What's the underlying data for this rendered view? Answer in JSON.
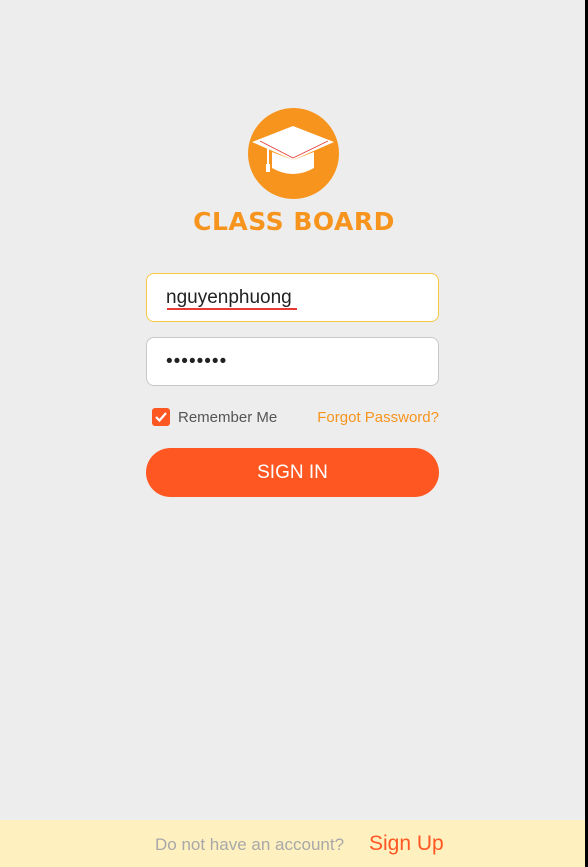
{
  "app": {
    "brand_name": "CLASS BOARD",
    "logo_icon": "graduation-cap-icon"
  },
  "login_form": {
    "username_value": "nguyenphuong",
    "password_value": "••••••••",
    "remember_me_label": "Remember Me",
    "remember_me_checked": true,
    "forgot_password_label": "Forgot Password?",
    "sign_in_label": "SIGN IN"
  },
  "footer": {
    "question_text": "Do not have an account?",
    "sign_up_label": "Sign Up"
  },
  "colors": {
    "brand_orange": "#f7941d",
    "accent_red_orange": "#ff5722",
    "background": "#ededed",
    "footer_background": "#fff0c0"
  }
}
